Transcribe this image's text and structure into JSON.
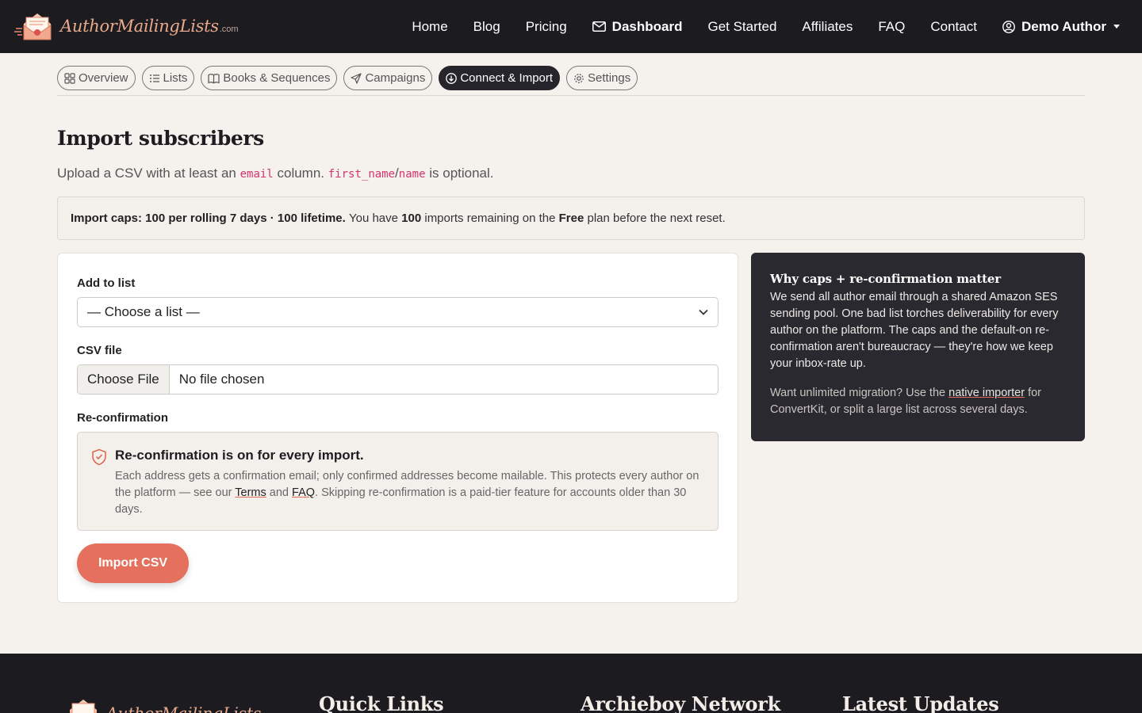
{
  "brand": {
    "name": "AuthorMailingLists",
    "suffix": ".com"
  },
  "nav": {
    "home": "Home",
    "blog": "Blog",
    "pricing": "Pricing",
    "dashboard": "Dashboard",
    "get_started": "Get Started",
    "affiliates": "Affiliates",
    "faq": "FAQ",
    "contact": "Contact",
    "user": "Demo Author"
  },
  "tabs": {
    "overview": "Overview",
    "lists": "Lists",
    "books": "Books & Sequences",
    "campaigns": "Campaigns",
    "connect": "Connect & Import",
    "settings": "Settings"
  },
  "page": {
    "title": "Import subscribers",
    "lead_prefix": "Upload a CSV with at least an",
    "lead_code_email": "email",
    "lead_mid": "column.",
    "lead_code_first": "first_name",
    "lead_slash": "/",
    "lead_code_name": "name",
    "lead_suffix": "is optional."
  },
  "caps": {
    "strong": "Import caps: 100 per rolling 7 days · 100 lifetime.",
    "t1": "You have",
    "remaining": "100",
    "t2": "imports remaining on the",
    "plan": "Free",
    "t3": "plan before the next reset."
  },
  "form": {
    "list_label": "Add to list",
    "list_value": "— Choose a list —",
    "csv_label": "CSV file",
    "file_button": "Choose File",
    "file_status": "No file chosen",
    "reconf_label": "Re-confirmation",
    "reconf_title": "Re-confirmation is on for every import.",
    "reconf_t1": "Each address gets a confirmation email; only confirmed addresses become mailable. This protects every author on the platform — see our",
    "reconf_terms": "Terms",
    "reconf_and": "and",
    "reconf_faq": "FAQ",
    "reconf_t2": ". Skipping re-confirmation is a paid-tier feature for accounts older than 30 days.",
    "submit": "Import CSV"
  },
  "side": {
    "title": "Why caps + re-confirmation matter",
    "p1": "We send all author email through a shared Amazon SES sending pool. One bad list torches deliverability for every author on the platform. The caps and the default-on re-confirmation aren't bureaucracy — they're how we keep your inbox-rate up.",
    "p2_prefix": "Want unlimited migration? Use the",
    "p2_link": "native importer",
    "p2_suffix": "for ConvertKit, or split a large list across several days."
  },
  "footer": {
    "brand": "AuthorMailingLists",
    "quick_links": "Quick Links",
    "network": "Archieboy Network",
    "updates": "Latest Updates"
  },
  "colors": {
    "accent": "#e4705d",
    "dark": "#1c1b20",
    "background": "#f5f2ee"
  }
}
